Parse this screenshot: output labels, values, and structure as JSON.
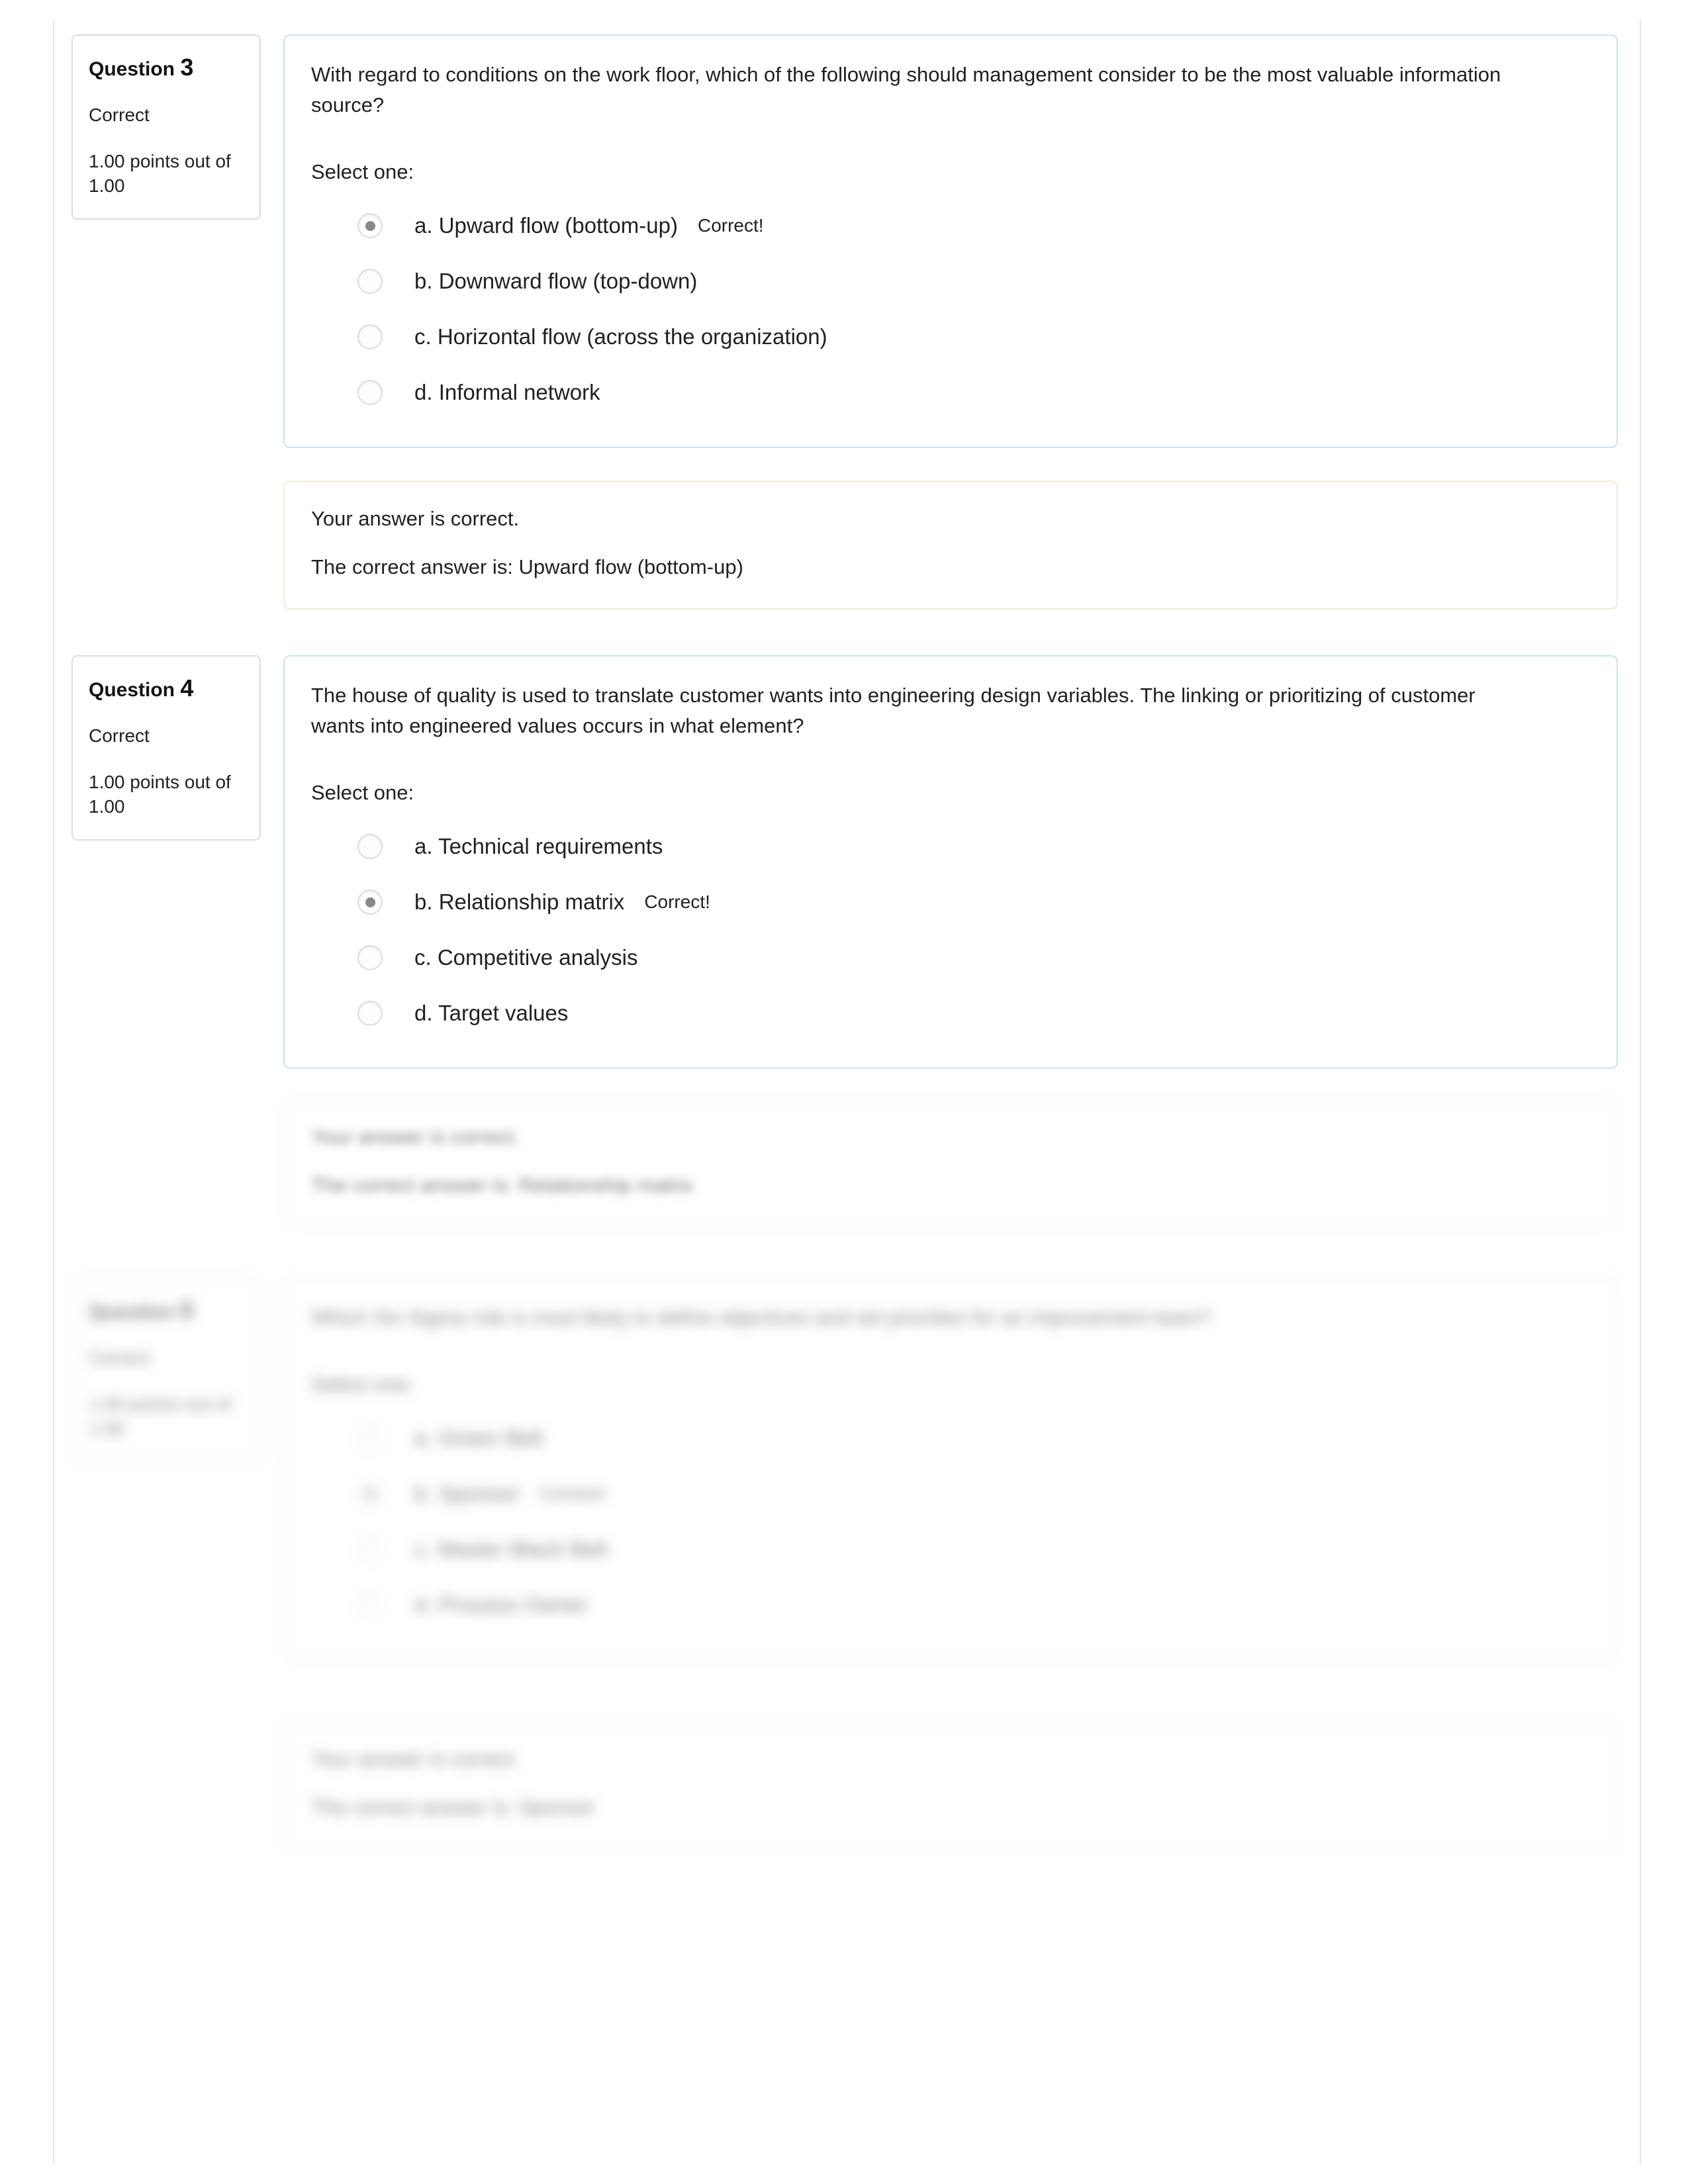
{
  "page": {
    "background_color": "#ffffff",
    "question_box_border_color": "#c7e5ea",
    "info_box_border_color": "#dcdcdc",
    "feedback_box_border_color": "#f3e9d9"
  },
  "labels": {
    "select_one": "Select one:",
    "question_word": "Question",
    "correct_flag": "Correct!"
  },
  "questions": [
    {
      "info": {
        "title_word": "Question",
        "number": "3",
        "state": "Correct",
        "grade": "1.00 points out of 1.00"
      },
      "text": "With regard to conditions on the work floor, which of the following should management consider to be the most valuable information source?",
      "select_one": "Select one:",
      "answers": [
        {
          "label": "a. Upward flow (bottom-up)",
          "selected": true,
          "flag": "Correct!"
        },
        {
          "label": "b. Downward flow (top-down)",
          "selected": false,
          "flag": ""
        },
        {
          "label": "c. Horizontal flow (across the organization)",
          "selected": false,
          "flag": ""
        },
        {
          "label": "d. Informal network",
          "selected": false,
          "flag": ""
        }
      ],
      "feedback": {
        "line1": "Your answer is correct.",
        "line2": "The correct answer is: Upward flow (bottom-up)"
      }
    },
    {
      "info": {
        "title_word": "Question",
        "number": "4",
        "state": "Correct",
        "grade": "1.00 points out of 1.00"
      },
      "text": "The house of quality is used to translate customer wants into engineering design variables. The linking or prioritizing of customer wants into engineered values occurs in what element?",
      "select_one": "Select one:",
      "answers": [
        {
          "label": "a. Technical requirements",
          "selected": false,
          "flag": ""
        },
        {
          "label": "b. Relationship matrix",
          "selected": true,
          "flag": "Correct!"
        },
        {
          "label": "c. Competitive analysis",
          "selected": false,
          "flag": ""
        },
        {
          "label": "d. Target values",
          "selected": false,
          "flag": ""
        }
      ],
      "feedback": {
        "line1": "Your answer is correct.",
        "line2": "The correct answer is: Relationship matrix"
      }
    },
    {
      "info": {
        "title_word": "Question",
        "number": "5",
        "state": "Correct",
        "grade": "1.00 points out of 1.00"
      },
      "text": "Which Six Sigma role is most likely to define objectives and set priorities for an improvement team?",
      "select_one": "Select one:",
      "answers": [
        {
          "label": "a. Green Belt",
          "selected": false,
          "flag": ""
        },
        {
          "label": "b. Sponsor",
          "selected": true,
          "flag": "Correct!"
        },
        {
          "label": "c. Master Black Belt",
          "selected": false,
          "flag": ""
        },
        {
          "label": "d. Process Owner",
          "selected": false,
          "flag": ""
        }
      ],
      "feedback": {
        "line1": "Your answer is correct.",
        "line2": "The correct answer is: Sponsor"
      }
    }
  ]
}
